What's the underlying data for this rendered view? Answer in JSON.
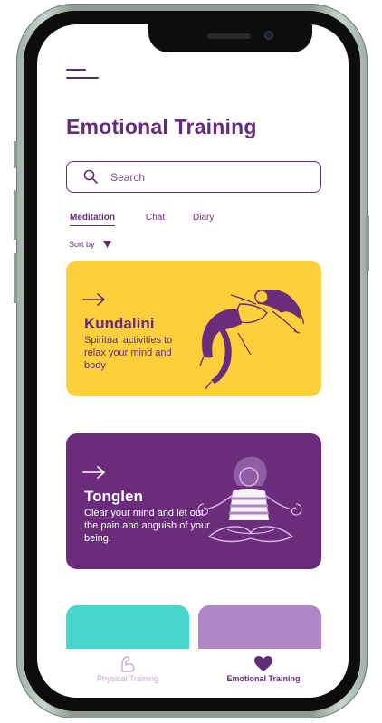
{
  "app": {
    "title": "Emotional Training"
  },
  "search": {
    "placeholder": "Search"
  },
  "tabs": [
    {
      "label": "Meditation",
      "active": true
    },
    {
      "label": "Chat",
      "active": false
    },
    {
      "label": "Diary",
      "active": false
    }
  ],
  "sort": {
    "label": "Sort by"
  },
  "cards": [
    {
      "title": "Kundalini",
      "description": "Spiritual activities to relax your mind and body",
      "background": "#fdcf3a"
    },
    {
      "title": "Tonglen",
      "description": "Clear your mind and let out the pain and anguish of your being.",
      "background": "#6a2c7b"
    },
    {
      "background": "#46d6cc"
    },
    {
      "background": "#b186c6"
    }
  ],
  "bottom_nav": [
    {
      "label": "Physical Training",
      "icon": "flexed-arm-icon",
      "active": false
    },
    {
      "label": "Emotional Training",
      "icon": "heart-icon",
      "active": true
    }
  ],
  "colors": {
    "primary": "#652b78",
    "accent_yellow": "#fdcf3a",
    "accent_teal": "#46d6cc",
    "accent_lavender": "#b186c6",
    "frame": "#8d9c93"
  }
}
